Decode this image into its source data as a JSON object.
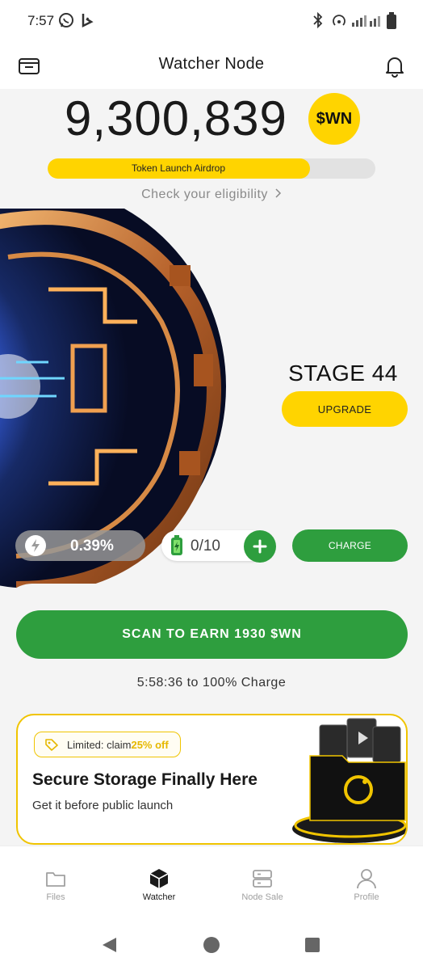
{
  "status_bar": {
    "time": "7:57",
    "icons": [
      "whatsapp-icon",
      "bing-icon",
      "bluetooth-icon",
      "hotspot-icon",
      "signal-icon",
      "battery-icon"
    ]
  },
  "header": {
    "title": "Watcher Node",
    "left_icon": "wallet-icon",
    "right_icon": "bell-icon"
  },
  "balance": {
    "value": "9,300,839",
    "token": "$WN"
  },
  "airdrop": {
    "label": "Token Launch Airdrop",
    "progress": 0.8,
    "check_link": "Check your eligibility"
  },
  "stage": {
    "title": "STAGE 44",
    "upgrade_label": "UPGRADE"
  },
  "stats": {
    "rate": "0.39%",
    "battery": "0/10",
    "charge_label": "CHARGE"
  },
  "scan": {
    "label": "SCAN TO EARN 1930 $WN",
    "timer": "5:58:36  to 100% Charge"
  },
  "promo": {
    "tag_prefix": "Limited: claim ",
    "tag_highlight": "25% off",
    "title": "Secure Storage Finally Here",
    "subtitle": "Get it before public launch"
  },
  "nav": {
    "items": [
      {
        "label": "Files",
        "icon": "folder-icon",
        "active": false
      },
      {
        "label": "Watcher",
        "icon": "cube-icon",
        "active": true
      },
      {
        "label": "Node Sale",
        "icon": "server-icon",
        "active": false
      },
      {
        "label": "Profile",
        "icon": "person-icon",
        "active": false
      }
    ]
  },
  "colors": {
    "accent_yellow": "#ffd400",
    "accent_green": "#2e9e3e"
  }
}
